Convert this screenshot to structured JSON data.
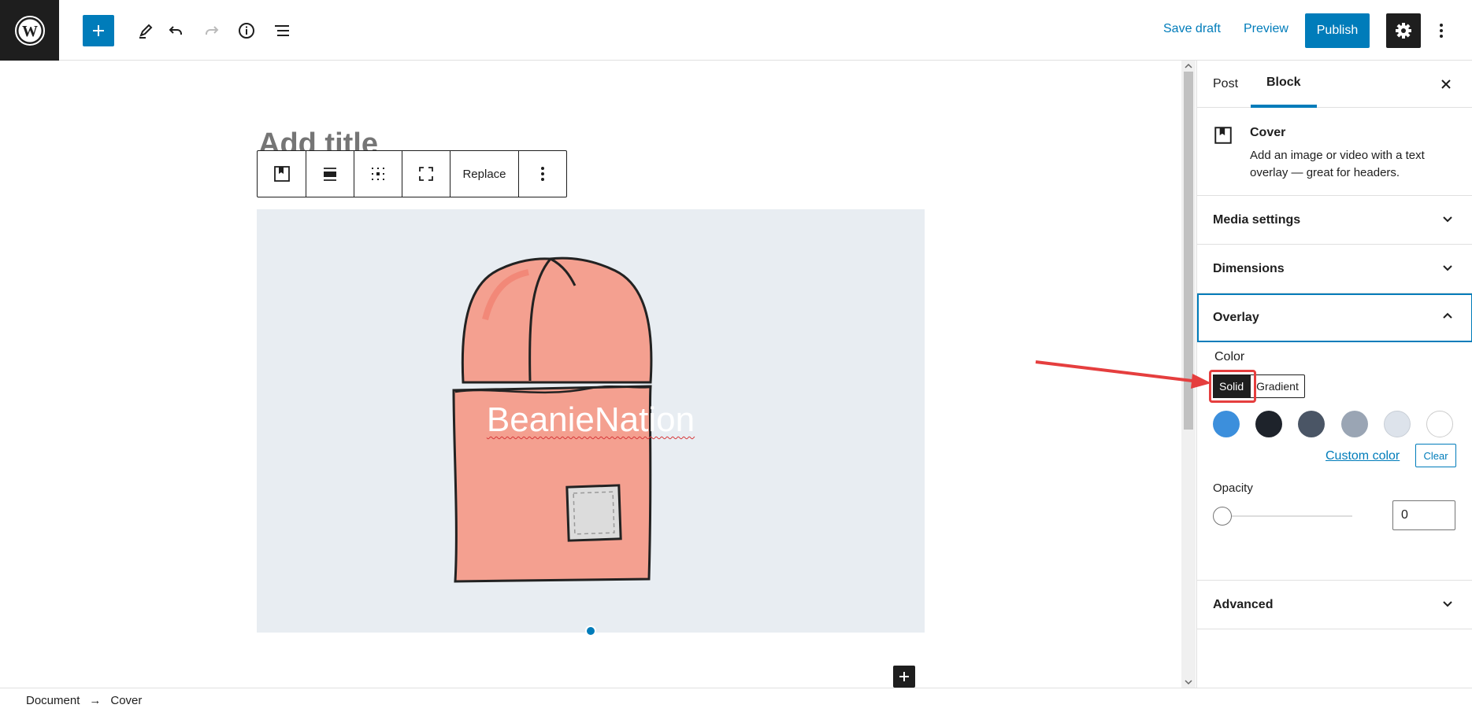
{
  "topbar": {
    "save_draft": "Save draft",
    "preview": "Preview",
    "publish": "Publish"
  },
  "editor": {
    "title_placeholder": "Add title",
    "toolbar": {
      "replace_label": "Replace"
    },
    "cover_text": "BeanieNation"
  },
  "footer": {
    "breadcrumb": [
      "Document",
      "→",
      "Cover"
    ]
  },
  "sidebar": {
    "tabs": [
      "Post",
      "Block"
    ],
    "active_tab": "Block",
    "block_card": {
      "title": "Cover",
      "description": "Add an image or video with a text overlay — great for headers."
    },
    "panels": {
      "media_settings": "Media settings",
      "dimensions": "Dimensions",
      "overlay": "Overlay",
      "advanced": "Advanced"
    },
    "overlay": {
      "color_label": "Color",
      "solid": "Solid",
      "gradient": "Gradient",
      "swatches": [
        "#3c8fdc",
        "#1e232b",
        "#4a5565",
        "#9aa5b4",
        "#dde3eb",
        "#ffffff"
      ],
      "custom_color": "Custom color",
      "clear": "Clear",
      "opacity_label": "Opacity",
      "opacity_value": "0"
    }
  },
  "colors": {
    "accent": "#007cba",
    "dark": "#1e1e1e",
    "annotation": "#e53e3e",
    "beanie": "#f29a88"
  }
}
